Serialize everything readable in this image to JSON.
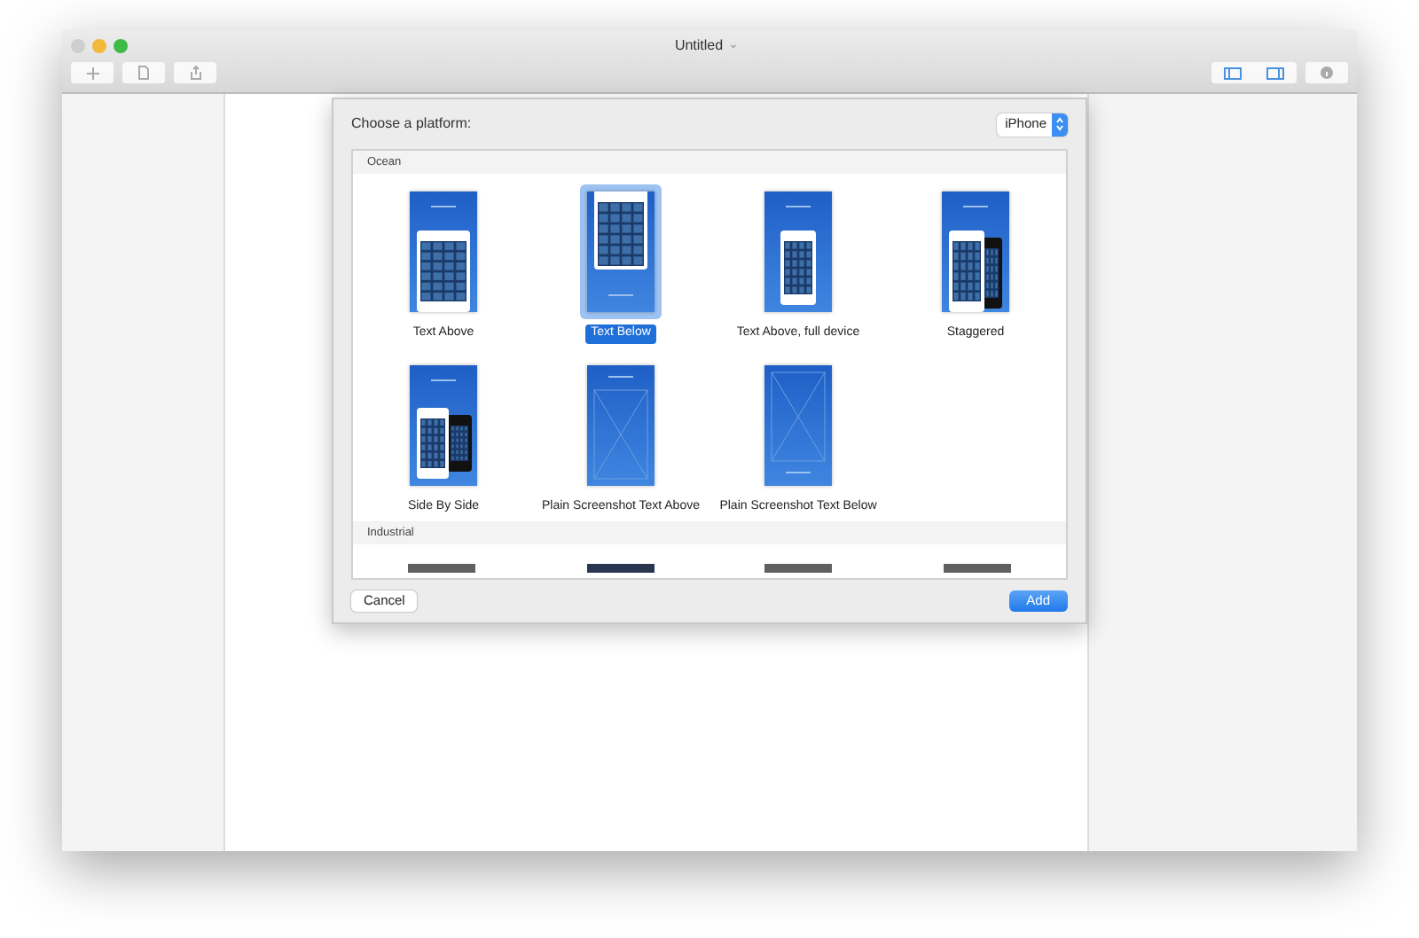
{
  "window": {
    "title": "Untitled",
    "title_menu": "⌄"
  },
  "sheet": {
    "prompt": "Choose a platform:",
    "platform": "iPhone",
    "sections": [
      {
        "name": "Ocean",
        "templates": [
          {
            "label": "Text Above",
            "kind": "text-above",
            "selected": false
          },
          {
            "label": "Text Below",
            "kind": "text-below",
            "selected": true
          },
          {
            "label": "Text Above, full device",
            "kind": "full-device",
            "selected": false
          },
          {
            "label": "Staggered",
            "kind": "staggered",
            "selected": false
          },
          {
            "label": "Side By Side",
            "kind": "side-by-side",
            "selected": false
          },
          {
            "label": "Plain Screenshot Text Above",
            "kind": "plain-above",
            "selected": false
          },
          {
            "label": "Plain Screenshot Text Below",
            "kind": "plain-below",
            "selected": false
          }
        ]
      },
      {
        "name": "Industrial"
      }
    ],
    "buttons": [
      {
        "label": "Cancel",
        "kind": "secondary"
      },
      {
        "label": "Add",
        "kind": "primary"
      }
    ]
  }
}
